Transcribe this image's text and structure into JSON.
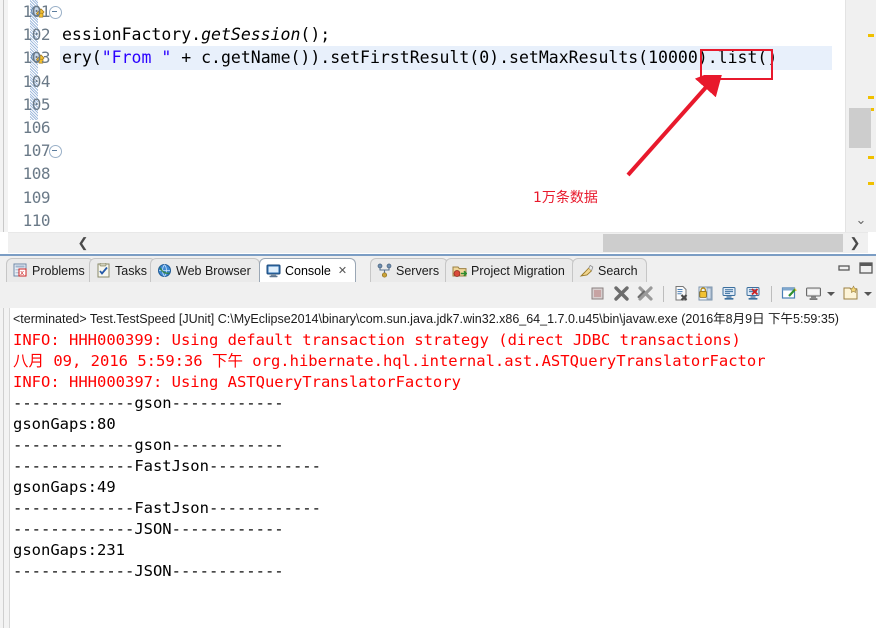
{
  "editor": {
    "line_numbers": [
      "101",
      "102",
      "103",
      "104",
      "105",
      "106",
      "107",
      "108",
      "109",
      "110"
    ],
    "code_lines": [
      {
        "n": "101",
        "text": ""
      },
      {
        "n": "102",
        "pre": "essionFactory.",
        "mth": "getSession",
        "post": "();"
      },
      {
        "n": "103",
        "pre": "ery(",
        "str": "\"From \"",
        "post": " + c.getName()).setFirstResult(0).setMaxResults(10000).list()"
      },
      {
        "n": "104",
        "text": ""
      },
      {
        "n": "105",
        "text": ""
      },
      {
        "n": "106",
        "text": ""
      },
      {
        "n": "107",
        "text": ""
      },
      {
        "n": "108",
        "text": ""
      },
      {
        "n": "109",
        "text": ""
      },
      {
        "n": "110",
        "text": ""
      }
    ],
    "line102_full": "essionFactory.getSession();",
    "line103_full": "ery(\"From \" + c.getName()).setFirstResult(0).setMaxResults(10000).list()",
    "line103_prefix": "ery(",
    "line103_string": "\"From \"",
    "line103_suffix": " + c.getName()).setFirstResult(0).setMaxResults(10000).list()",
    "line102_prefix": "essionFactory.",
    "line102_method": "getSession",
    "line102_suffix": "();"
  },
  "annotation": {
    "highlight_value": "10000",
    "note_text": "1万条数据",
    "color": "#e8192c"
  },
  "tabs": [
    {
      "label": "Problems",
      "icon": "problems-icon",
      "active": false
    },
    {
      "label": "Tasks",
      "icon": "tasks-icon",
      "active": false
    },
    {
      "label": "Web Browser",
      "icon": "web-browser-icon",
      "active": false
    },
    {
      "label": "Console",
      "icon": "console-icon",
      "active": true,
      "close": "✕"
    },
    {
      "label": "Servers",
      "icon": "servers-icon",
      "active": false
    },
    {
      "label": "Project Migration",
      "icon": "project-migration-icon",
      "active": false
    },
    {
      "label": "Search",
      "icon": "search-icon",
      "active": false
    }
  ],
  "view_buttons": {
    "minimize": "minimize-icon",
    "maximize": "maximize-icon"
  },
  "toolbar_icons": [
    "terminate-icon",
    "remove-launch-icon",
    "remove-all-terminated-icon",
    "clear-console-icon",
    "scroll-lock-icon",
    "pin-console-icon",
    "close-console-icon",
    "display-selected-console-icon",
    "open-console-icon",
    "new-console-view-icon"
  ],
  "console": {
    "process_line": "<terminated> Test.TestSpeed [JUnit] C:\\MyEclipse2014\\binary\\com.sun.java.jdk7.win32.x86_64_1.7.0.u45\\bin\\javaw.exe (2016年8月9日 下午5:59:35)",
    "lines": [
      {
        "text": "INFO: HHH000399: Using default transaction strategy (direct JDBC transactions)",
        "err": true
      },
      {
        "text": "八月 09, 2016 5:59:36 下午 org.hibernate.hql.internal.ast.ASTQueryTranslatorFactor",
        "err": true
      },
      {
        "text": "INFO: HHH000397: Using ASTQueryTranslatorFactory",
        "err": true
      },
      {
        "text": "-------------gson------------",
        "err": false
      },
      {
        "text": "gsonGaps:80",
        "err": false
      },
      {
        "text": "-------------gson------------",
        "err": false
      },
      {
        "text": "-------------FastJson------------",
        "err": false
      },
      {
        "text": "gsonGaps:49",
        "err": false
      },
      {
        "text": "-------------FastJson------------",
        "err": false
      },
      {
        "text": "-------------JSON------------",
        "err": false
      },
      {
        "text": "gsonGaps:231",
        "err": false
      },
      {
        "text": "-------------JSON------------",
        "err": false
      }
    ]
  },
  "scrollbars": {
    "h_left_arrow": "❮",
    "h_right_arrow": "❯",
    "v_down_arrow": "⌄"
  }
}
